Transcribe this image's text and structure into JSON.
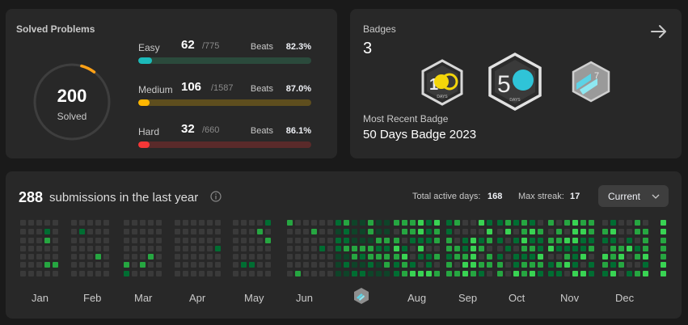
{
  "solved": {
    "title": "Solved Problems",
    "total": "200",
    "total_label": "Solved",
    "ring_arc_fraction": 0.06,
    "difficulties": [
      {
        "name": "Easy",
        "solved": "62",
        "total": "/775",
        "beats_label": "Beats",
        "beats": "82.3%",
        "fraction": 0.08,
        "color": "#1cbaba",
        "track": "#2b4a3c"
      },
      {
        "name": "Medium",
        "solved": "106",
        "total": "/1587",
        "beats_label": "Beats",
        "beats": "87.0%",
        "fraction": 0.067,
        "color": "#ffb700",
        "track": "#5e4e1e"
      },
      {
        "name": "Hard",
        "solved": "32",
        "total": "/660",
        "beats_label": "Beats",
        "beats": "86.1%",
        "fraction": 0.048,
        "color": "#f63737",
        "track": "#5a2a2a"
      }
    ]
  },
  "badges": {
    "label": "Badges",
    "count": "3",
    "recent_label": "Most Recent Badge",
    "recent_name": "50 Days Badge 2023",
    "items": [
      {
        "name": "100-days-badge-icon",
        "text": "DAYS"
      },
      {
        "name": "50-days-badge-icon",
        "text": "DAYS",
        "big": "5"
      },
      {
        "name": "monthly-badge-icon",
        "text": "7"
      }
    ]
  },
  "submissions": {
    "count": "288",
    "text": "submissions in the last year",
    "active_label": "Total active days:",
    "active_value": "168",
    "streak_label": "Max streak:",
    "streak_value": "17",
    "period": "Current",
    "months": [
      "Jan",
      "Feb",
      "Mar",
      "Apr",
      "May",
      "Jun",
      "",
      "Aug",
      "Sep",
      "Oct",
      "Nov",
      "Dec"
    ]
  },
  "colors": {
    "empty": "#3a3a3a",
    "l1": "#0e4429",
    "l2": "#006d32",
    "l3": "#26a641",
    "l4": "#39d353"
  }
}
